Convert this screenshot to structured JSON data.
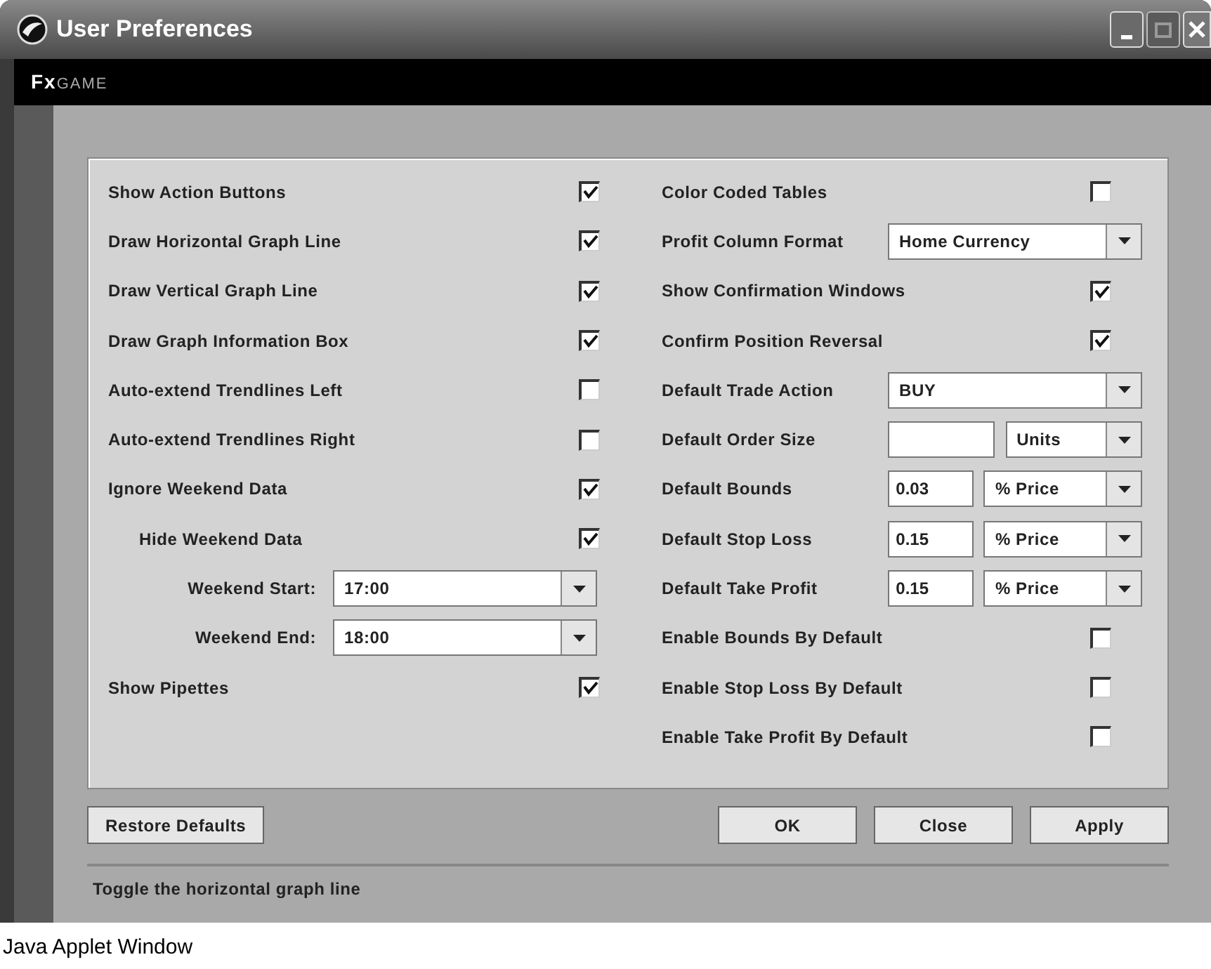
{
  "window": {
    "title": "User Preferences"
  },
  "brand": {
    "lead": "Fx",
    "rest": "GAME"
  },
  "left": [
    {
      "kind": "checkbox",
      "label": "Show Action Buttons",
      "checked": true
    },
    {
      "kind": "checkbox",
      "label": "Draw Horizontal Graph Line",
      "checked": true
    },
    {
      "kind": "checkbox",
      "label": "Draw Vertical Graph Line",
      "checked": true
    },
    {
      "kind": "checkbox",
      "label": "Draw Graph Information Box",
      "checked": true
    },
    {
      "kind": "checkbox",
      "label": "Auto-extend Trendlines Left",
      "checked": false
    },
    {
      "kind": "checkbox",
      "label": "Auto-extend Trendlines Right",
      "checked": false
    },
    {
      "kind": "checkbox",
      "label": "Ignore Weekend Data",
      "checked": true,
      "children": [
        {
          "kind": "checkbox",
          "label": "Hide Weekend Data",
          "checked": true,
          "children": [
            {
              "kind": "select",
              "label": "Weekend Start:",
              "value": "17:00"
            },
            {
              "kind": "select",
              "label": "Weekend End:",
              "value": "18:00"
            }
          ]
        }
      ]
    },
    {
      "kind": "checkbox",
      "label": "Show Pipettes",
      "checked": true
    }
  ],
  "right": [
    {
      "kind": "checkbox",
      "label": "Color Coded Tables",
      "checked": false
    },
    {
      "kind": "select",
      "label": "Profit Column Format",
      "value": "Home Currency"
    },
    {
      "kind": "checkbox",
      "label": "Show Confirmation Windows",
      "checked": true
    },
    {
      "kind": "checkbox",
      "label": "Confirm Position Reversal",
      "checked": true
    },
    {
      "kind": "select",
      "label": "Default Trade Action",
      "value": "BUY"
    },
    {
      "kind": "input-select",
      "label": "Default Order Size",
      "unit": "Units"
    },
    {
      "kind": "input-select",
      "label": "Default Bounds",
      "input": "0.03",
      "unit": "% Price"
    },
    {
      "kind": "input-select",
      "label": "Default Stop Loss",
      "input": "0.15",
      "unit": "% Price"
    },
    {
      "kind": "input-select",
      "label": "Default Take Profit",
      "input": "0.15",
      "unit": "% Price"
    },
    {
      "kind": "checkbox",
      "label": "Enable Bounds By Default",
      "checked": false
    },
    {
      "kind": "checkbox",
      "label": "Enable Stop Loss By Default",
      "checked": false
    },
    {
      "kind": "checkbox",
      "label": "Enable Take Profit By Default",
      "checked": false
    }
  ],
  "buttons": {
    "left": [
      "Restore Defaults"
    ],
    "right": [
      "OK",
      "Close",
      "Apply"
    ]
  },
  "status_bar": "Toggle the horizontal graph line",
  "footer": "Java Applet Window"
}
